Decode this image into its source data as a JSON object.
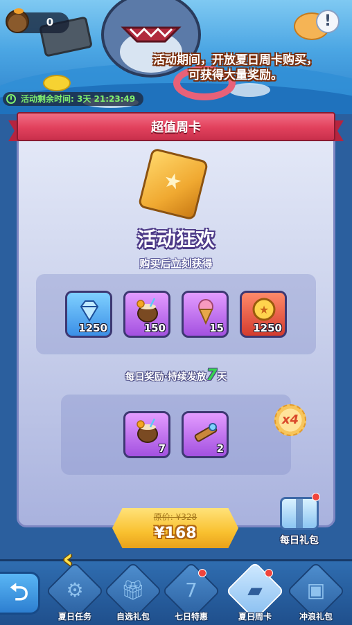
{
  "currency": {
    "icon": "coconut-drink-icon",
    "value": "0"
  },
  "notice": {
    "line1": "活动期间，开放夏日周卡购买，",
    "line2": "可获得大量奖励。"
  },
  "timer": {
    "label": "活动剩余时间:",
    "value": "3天 21:23:49"
  },
  "ribbon_title": "超值周卡",
  "event_title": "活动狂欢",
  "instant": {
    "label": "购买后立刻获得",
    "items": [
      {
        "icon": "blue-diamond-icon",
        "qty": "1250",
        "color": "blue"
      },
      {
        "icon": "coconut-drink-icon",
        "qty": "150",
        "color": "purple"
      },
      {
        "icon": "ice-cream-icon",
        "qty": "15",
        "color": "purple"
      },
      {
        "icon": "gold-medal-icon",
        "qty": "1250",
        "color": "red"
      }
    ]
  },
  "daily": {
    "label_prefix": "每日奖励·持续发放",
    "days": "7",
    "label_suffix": "天",
    "multiplier": "x4",
    "items": [
      {
        "icon": "coconut-drink-icon",
        "qty": "7",
        "color": "purple"
      },
      {
        "icon": "spyglass-icon",
        "qty": "2",
        "color": "purple"
      }
    ]
  },
  "price": {
    "original": "原价: ¥328",
    "current": "¥168"
  },
  "daily_gift": {
    "label": "每日礼包",
    "icon": "gift-chest-icon",
    "has_notification": true
  },
  "nav": {
    "tabs": [
      {
        "label": "夏日任务",
        "icon": "task-icon",
        "active": false,
        "dot": false
      },
      {
        "label": "自选礼包",
        "icon": "gift-icon",
        "active": false,
        "dot": false
      },
      {
        "label": "七日特惠",
        "icon": "seven-day-icon",
        "active": false,
        "dot": true
      },
      {
        "label": "夏日周卡",
        "icon": "ticket-icon",
        "active": true,
        "dot": true
      },
      {
        "label": "冲浪礼包",
        "icon": "surf-gift-icon",
        "active": false,
        "dot": false
      }
    ]
  },
  "colors": {
    "accent_red": "#e1405c",
    "gold": "#f9c130",
    "green_timer": "#7ff06f"
  }
}
